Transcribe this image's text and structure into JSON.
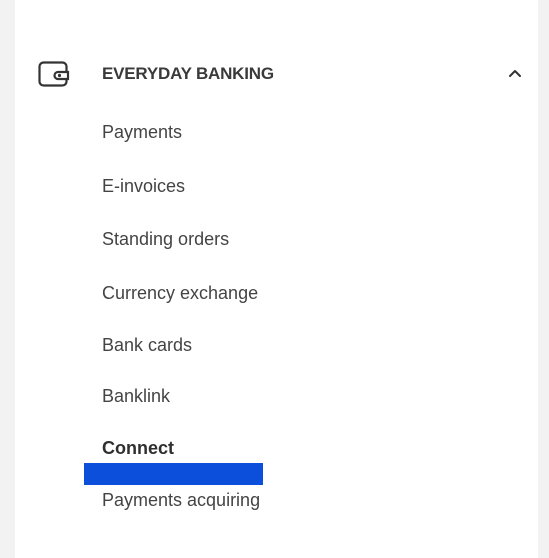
{
  "section": {
    "title": "EVERYDAY BANKING",
    "icon": "wallet-icon",
    "toggle_icon": "chevron-up-icon",
    "expanded": true
  },
  "items": [
    {
      "label": "Payments",
      "active": false
    },
    {
      "label": "E-invoices",
      "active": false
    },
    {
      "label": "Standing orders",
      "active": false
    },
    {
      "label": "Currency exchange",
      "active": false
    },
    {
      "label": "Bank cards",
      "active": false
    },
    {
      "label": "Banklink",
      "active": false
    },
    {
      "label": "Connect",
      "active": true
    },
    {
      "label": "Payments acquiring",
      "active": false
    }
  ],
  "colors": {
    "text": "#444444",
    "title": "#3a3a3a",
    "active_marker": "#0b4fdb",
    "edge": "#f2f2f2"
  }
}
